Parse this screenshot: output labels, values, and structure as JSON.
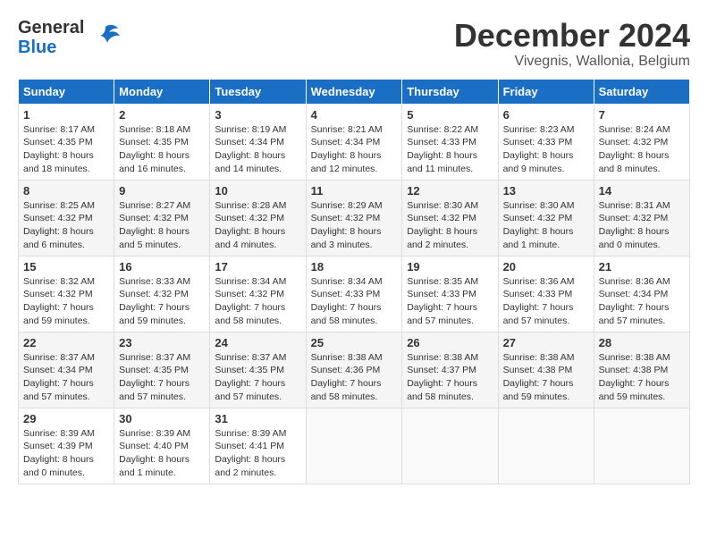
{
  "header": {
    "logo_general": "General",
    "logo_blue": "Blue",
    "month_title": "December 2024",
    "location": "Vivegnis, Wallonia, Belgium"
  },
  "days_of_week": [
    "Sunday",
    "Monday",
    "Tuesday",
    "Wednesday",
    "Thursday",
    "Friday",
    "Saturday"
  ],
  "weeks": [
    [
      {
        "day": "1",
        "sunrise": "8:17 AM",
        "sunset": "4:35 PM",
        "daylight": "8 hours and 18 minutes"
      },
      {
        "day": "2",
        "sunrise": "8:18 AM",
        "sunset": "4:35 PM",
        "daylight": "8 hours and 16 minutes"
      },
      {
        "day": "3",
        "sunrise": "8:19 AM",
        "sunset": "4:34 PM",
        "daylight": "8 hours and 14 minutes"
      },
      {
        "day": "4",
        "sunrise": "8:21 AM",
        "sunset": "4:34 PM",
        "daylight": "8 hours and 12 minutes"
      },
      {
        "day": "5",
        "sunrise": "8:22 AM",
        "sunset": "4:33 PM",
        "daylight": "8 hours and 11 minutes"
      },
      {
        "day": "6",
        "sunrise": "8:23 AM",
        "sunset": "4:33 PM",
        "daylight": "8 hours and 9 minutes"
      },
      {
        "day": "7",
        "sunrise": "8:24 AM",
        "sunset": "4:32 PM",
        "daylight": "8 hours and 8 minutes"
      }
    ],
    [
      {
        "day": "8",
        "sunrise": "8:25 AM",
        "sunset": "4:32 PM",
        "daylight": "8 hours and 6 minutes"
      },
      {
        "day": "9",
        "sunrise": "8:27 AM",
        "sunset": "4:32 PM",
        "daylight": "8 hours and 5 minutes"
      },
      {
        "day": "10",
        "sunrise": "8:28 AM",
        "sunset": "4:32 PM",
        "daylight": "8 hours and 4 minutes"
      },
      {
        "day": "11",
        "sunrise": "8:29 AM",
        "sunset": "4:32 PM",
        "daylight": "8 hours and 3 minutes"
      },
      {
        "day": "12",
        "sunrise": "8:30 AM",
        "sunset": "4:32 PM",
        "daylight": "8 hours and 2 minutes"
      },
      {
        "day": "13",
        "sunrise": "8:30 AM",
        "sunset": "4:32 PM",
        "daylight": "8 hours and 1 minute"
      },
      {
        "day": "14",
        "sunrise": "8:31 AM",
        "sunset": "4:32 PM",
        "daylight": "8 hours and 0 minutes"
      }
    ],
    [
      {
        "day": "15",
        "sunrise": "8:32 AM",
        "sunset": "4:32 PM",
        "daylight": "7 hours and 59 minutes"
      },
      {
        "day": "16",
        "sunrise": "8:33 AM",
        "sunset": "4:32 PM",
        "daylight": "7 hours and 59 minutes"
      },
      {
        "day": "17",
        "sunrise": "8:34 AM",
        "sunset": "4:32 PM",
        "daylight": "7 hours and 58 minutes"
      },
      {
        "day": "18",
        "sunrise": "8:34 AM",
        "sunset": "4:33 PM",
        "daylight": "7 hours and 58 minutes"
      },
      {
        "day": "19",
        "sunrise": "8:35 AM",
        "sunset": "4:33 PM",
        "daylight": "7 hours and 57 minutes"
      },
      {
        "day": "20",
        "sunrise": "8:36 AM",
        "sunset": "4:33 PM",
        "daylight": "7 hours and 57 minutes"
      },
      {
        "day": "21",
        "sunrise": "8:36 AM",
        "sunset": "4:34 PM",
        "daylight": "7 hours and 57 minutes"
      }
    ],
    [
      {
        "day": "22",
        "sunrise": "8:37 AM",
        "sunset": "4:34 PM",
        "daylight": "7 hours and 57 minutes"
      },
      {
        "day": "23",
        "sunrise": "8:37 AM",
        "sunset": "4:35 PM",
        "daylight": "7 hours and 57 minutes"
      },
      {
        "day": "24",
        "sunrise": "8:37 AM",
        "sunset": "4:35 PM",
        "daylight": "7 hours and 57 minutes"
      },
      {
        "day": "25",
        "sunrise": "8:38 AM",
        "sunset": "4:36 PM",
        "daylight": "7 hours and 58 minutes"
      },
      {
        "day": "26",
        "sunrise": "8:38 AM",
        "sunset": "4:37 PM",
        "daylight": "7 hours and 58 minutes"
      },
      {
        "day": "27",
        "sunrise": "8:38 AM",
        "sunset": "4:38 PM",
        "daylight": "7 hours and 59 minutes"
      },
      {
        "day": "28",
        "sunrise": "8:38 AM",
        "sunset": "4:38 PM",
        "daylight": "7 hours and 59 minutes"
      }
    ],
    [
      {
        "day": "29",
        "sunrise": "8:39 AM",
        "sunset": "4:39 PM",
        "daylight": "8 hours and 0 minutes"
      },
      {
        "day": "30",
        "sunrise": "8:39 AM",
        "sunset": "4:40 PM",
        "daylight": "8 hours and 1 minute"
      },
      {
        "day": "31",
        "sunrise": "8:39 AM",
        "sunset": "4:41 PM",
        "daylight": "8 hours and 2 minutes"
      },
      null,
      null,
      null,
      null
    ]
  ]
}
